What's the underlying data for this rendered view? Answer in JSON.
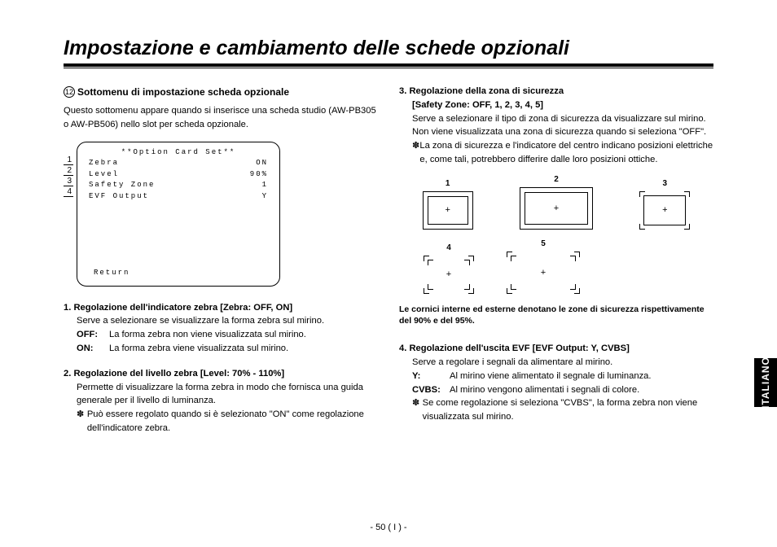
{
  "title": "Impostazione e cambiamento delle schede opzionali",
  "section": {
    "number": "12",
    "heading": "Sottomenu di impostazione scheda opzionale",
    "intro": "Questo sottomenu appare quando si inserisce una scheda studio (AW-PB305 o AW-PB506) nello slot per scheda opzionale."
  },
  "menu": {
    "title": "**Option Card Set**",
    "rows": [
      {
        "label": "Zebra",
        "value": "ON"
      },
      {
        "label": "Level",
        "value": "90%"
      },
      {
        "label": "Safety Zone",
        "value": "1"
      },
      {
        "label": "EVF Output",
        "value": "Y"
      }
    ],
    "return": "Return",
    "nums": [
      "1",
      "2",
      "3",
      "4"
    ]
  },
  "items": [
    {
      "head": "1. Regolazione dell'indicatore zebra [Zebra: OFF, ON]",
      "desc": "Serve a selezionare se visualizzare la forma zebra sul mirino.",
      "opts": [
        {
          "k": "OFF:",
          "v": "La forma zebra non viene visualizzata sul mirino."
        },
        {
          "k": "ON:",
          "v": "La forma zebra viene visualizzata sul mirino."
        }
      ]
    },
    {
      "head": "2. Regolazione del livello zebra [Level: 70% - 110%]",
      "desc": "Permette di visualizzare la forma zebra in modo che fornisca una guida generale per il livello di luminanza.",
      "note": "Può essere regolato quando si è selezionato \"ON\" come regolazione dell'indicatore zebra."
    },
    {
      "head": "3. Regolazione della zona di sicurezza",
      "head2": "[Safety Zone: OFF, 1, 2, 3, 4, 5]",
      "desc": "Serve a selezionare il tipo di zona di sicurezza da visualizzare sul mirino. Non viene visualizzata una zona di sicurezza quando si seleziona \"OFF\".",
      "note": "La zona di sicurezza e l'indicatore del centro indicano posizioni elettriche e, come tali, potrebbero differire dalle loro posizioni ottiche."
    },
    {
      "head": "4. Regolazione dell'uscita EVF [EVF Output: Y, CVBS]",
      "desc": "Serve a regolare i segnali da alimentare al mirino.",
      "opts": [
        {
          "k": "Y:",
          "v": "Al mirino viene alimentato il segnale di luminanza."
        },
        {
          "k": "CVBS:",
          "v": "Al mirino vengono alimentati i segnali di colore."
        }
      ],
      "note": "Se come regolazione si seleziona \"CVBS\", la forma zebra non viene visualizzata sul mirino."
    }
  ],
  "sz_labels": [
    "1",
    "2",
    "3",
    "4",
    "5"
  ],
  "sz_caption": "Le cornici interne ed esterne denotano le zone di sicurezza rispettivamente del 90% e del 95%.",
  "language_tab": "ITALIANO",
  "page_number": "- 50 ( I ) -",
  "note_symbol": "✽"
}
